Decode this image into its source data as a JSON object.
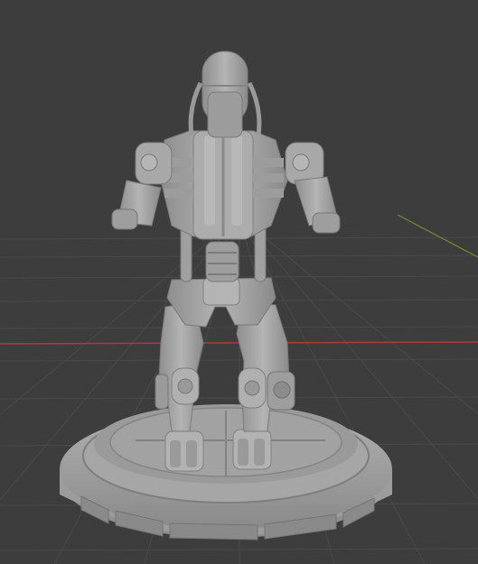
{
  "viewport": {
    "background_color": "#3d3d3d",
    "grid_color": "#4a4a4a",
    "x_axis_color": "#b23a3a",
    "y_axis_color": "#6f8f2e"
  },
  "scene": {
    "model_color": "#a8a8a8",
    "model_shadow_color": "#7c7c7c",
    "model_highlight_color": "#c6c6c6",
    "parts": [
      "base",
      "base-panels",
      "left-foot",
      "right-foot",
      "left-leg",
      "right-leg",
      "pelvis",
      "spine",
      "torso",
      "head",
      "left-arm",
      "right-arm",
      "back-cables"
    ]
  }
}
